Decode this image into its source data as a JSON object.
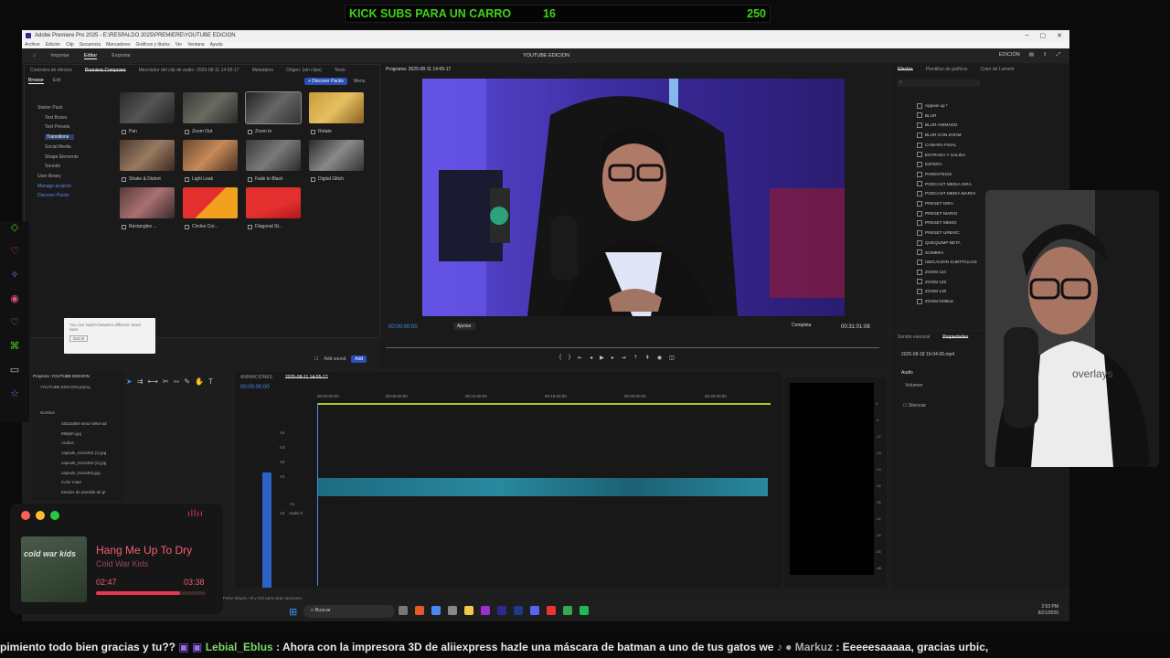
{
  "banner": {
    "text": "KICK SUBS PARA UN CARRO",
    "current": "16",
    "goal": "250"
  },
  "window": {
    "title": "Adobe Premiere Pro 2025 - E:\\RESPALDO 2025\\PREMIERE\\YOUTUBE EDICION",
    "menus": [
      "Archivo",
      "Edición",
      "Clip",
      "Secuencia",
      "Marcadores",
      "Gráficos y títulos",
      "Ver",
      "Ventana",
      "Ayuda"
    ],
    "nav": [
      "Importar",
      "Editar",
      "Exportar"
    ],
    "workspace": "YOUTUBE EDICION",
    "right_label": "EDICIÓN"
  },
  "effects_panel": {
    "tabs": [
      "Controles de efectos",
      "Premiere Composer",
      "Mezclador del clip de audio: 2025-08-11 14-55-17",
      "Metadatos",
      "Origen: (sin clips)",
      "Texto"
    ],
    "subtabs": [
      "Browse",
      "Edit"
    ],
    "discover": "+ Discover Packs",
    "menu": "Menu",
    "tree": [
      "Starter Pack",
      "Text Boxes",
      "Text Presets",
      "Transitions",
      "Social Media",
      "Shape Elements",
      "Sounds",
      "User library",
      "Manage projects",
      "Discover Packs"
    ],
    "thumbs": [
      "Pan",
      "Zoom Out",
      "Zoom In",
      "Rotate",
      "Shake & Distort",
      "Light Leak",
      "Fade to Black",
      "Digital Glitch",
      "Rectangles ...",
      "Circles Cor...",
      "Diagonal St..."
    ],
    "add_sound": "Add sound",
    "add": "Add"
  },
  "popup": {
    "text": "You can switch between different views here.",
    "btn": "Got it!"
  },
  "program": {
    "title": "Programa: 2025-08-11 14-55-17",
    "timecode": "00:00:00:00",
    "fit": "Ajustar",
    "quality": "Completa",
    "duration": "00:31:01:08"
  },
  "effects_right": {
    "tabs": [
      "Efectos",
      "Plantillas de gráficos",
      "Color de Lumetri"
    ],
    "items": [
      "Appear up *",
      "BLUR",
      "BLUR ANIMADO",
      "BLUR CON ZOOM",
      "CAMARA FINAL",
      "ENTRADA Y SALIDA",
      "ESFERA",
      "PARENTESIS",
      "PODCAST MEDIA ISRA",
      "PODCAST MEDIA MARIO",
      "PRESET ISRA",
      "PRESET MARIO",
      "PRESET MEMO",
      "PRESET URBVIC",
      "QUEQUIMP BETA",
      "SOMBRA",
      "UBICACION SUBTITULOS",
      "ZOOM 110",
      "ZOOM 120",
      "ZOOM 130",
      "ZOOM DOBLE"
    ]
  },
  "properties": {
    "tabs": [
      "Sonido esencial",
      "Propiedades"
    ],
    "file": "2025-08-18 19-04-06.mp4",
    "section": "Audio",
    "volume": "Volumen",
    "mute": "Silenciar"
  },
  "project": {
    "title": "Proyecto: YOUTUBE EDICION",
    "file": "YOUTUBE EDICION.prproj",
    "col": "Nombre",
    "items": [
      "483a3d68-4e42-4993-ad",
      "995j8m.jpg",
      "Audios",
      "capsule_616x353 (1).jpg",
      "capsule_616x353 (2).jpg",
      "capsule_616x353.jpg",
      "Color mate",
      "Medios de plantilla de gr"
    ]
  },
  "timeline": {
    "tabs": [
      "ANIMACIONES",
      "2025-08-11 14-55-17"
    ],
    "timecode": "00:00:00:00",
    "ruler": [
      "00:00:00:00",
      "00:05:00:00",
      "00:10:00:00",
      "00:15:00:00",
      "00:20:00:00",
      "00:25:00:00"
    ],
    "tracks": [
      "V4",
      "V3",
      "V2",
      "V1",
      "A1",
      "A2"
    ],
    "audio2": "Audio 2",
    "hint": "Pulse Mayús, Alt y Ctrl para otras opciones."
  },
  "meter_ticks": [
    "0",
    "-6",
    "-12",
    "-18",
    "-24",
    "-30",
    "-36",
    "-42",
    "-48",
    "-54",
    "-dB"
  ],
  "taskbar": {
    "search": "Buscar",
    "time": "2:53 PM",
    "date": "8/21/2025"
  },
  "music": {
    "song": "Hang Me Up To Dry",
    "artist": "Cold War Kids",
    "current": "02:47",
    "total": "03:38",
    "progress": 0.77,
    "album": "cold war kids"
  },
  "chat": {
    "pre": "pimiento todo bien gracias y tu??",
    "user": "Lebial_Eblus",
    "msg": ": Ahora con la impresora 3D de aliiexpress hazle una máscara de batman a uno de tus gatos we",
    "user2": "Markuz",
    "msg2": ": Eeeeesaaaaa, gracias urbic,"
  },
  "colors": {
    "accent": "#2b4fb6",
    "timecode": "#4a8af4",
    "kick": "#3ed317",
    "music": "#e63950"
  }
}
